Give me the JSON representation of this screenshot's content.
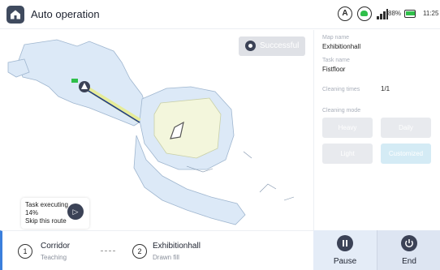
{
  "header": {
    "title": "Auto operation",
    "battery": "88%",
    "time": "11:25",
    "status_a": "A"
  },
  "map": {
    "status_badge": "Successful",
    "task": {
      "line1": "Task executing",
      "progress": "14%",
      "skip": "Skip this route"
    }
  },
  "panel": {
    "map_name_label": "Map name",
    "map_name": "Exhibitionhall",
    "task_name_label": "Task name",
    "task_name": "Fistfloor",
    "cleaning_times_label": "Cleaning times",
    "cleaning_times": "1/1",
    "cleaning_mode_label": "Cleaning mode",
    "modes": [
      "Heavy",
      "Daily",
      "Light",
      "Customized"
    ],
    "selected_mode": "Customized"
  },
  "route": {
    "steps": [
      {
        "number": "1",
        "title": "Corridor",
        "subtitle": "Teaching"
      },
      {
        "number": "2",
        "title": "Exhibitionhall",
        "subtitle": "Drawn fill"
      }
    ]
  },
  "actions": {
    "pause": "Pause",
    "end": "End"
  },
  "colors": {
    "accent": "#3b7fdc",
    "dark": "#3b4256",
    "status_green": "#2fbf4a",
    "map_fill": "#dce9f7",
    "area_fill": "#f3f6dc"
  }
}
